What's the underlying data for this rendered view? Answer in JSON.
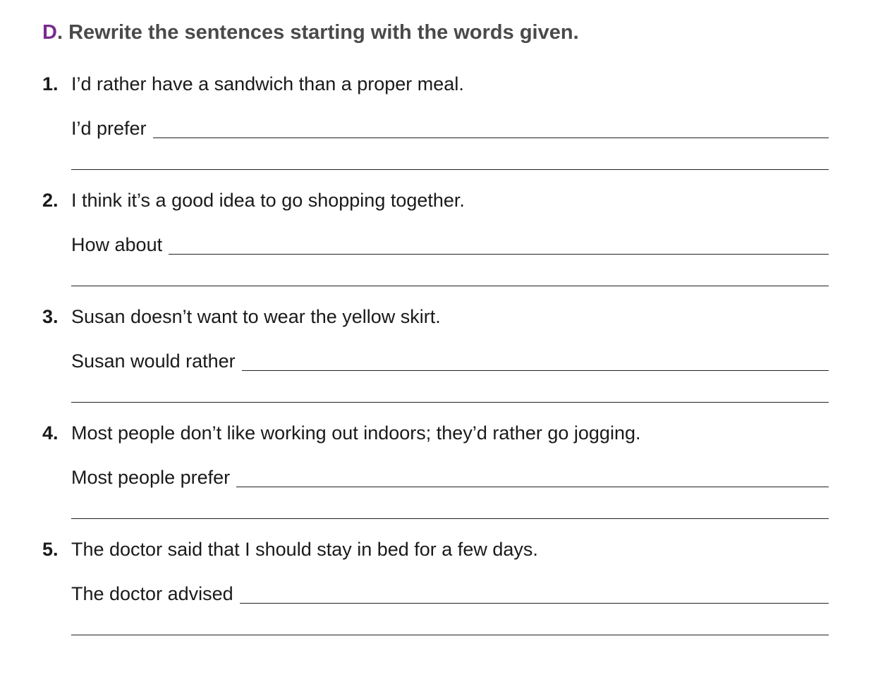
{
  "heading": {
    "letter": "D",
    "dot": ".",
    "instruction": "Rewrite the sentences starting with the words given."
  },
  "exercises": [
    {
      "number": "1.",
      "sentence": "I’d rather have a sandwich than a proper meal.",
      "prompt": "I’d prefer"
    },
    {
      "number": "2.",
      "sentence": "I think it’s a good idea to go shopping together.",
      "prompt": "How about"
    },
    {
      "number": "3.",
      "sentence": "Susan doesn’t want to wear the yellow skirt.",
      "prompt": "Susan would rather"
    },
    {
      "number": "4.",
      "sentence": "Most people don’t like working out indoors; they’d rather go jogging.",
      "prompt": "Most people prefer"
    },
    {
      "number": "5.",
      "sentence": "The doctor said that I should stay in bed for a few days.",
      "prompt": "The doctor advised"
    }
  ],
  "colors": {
    "heading_letter": "#7a2b8f",
    "heading_text": "#4a4a4a",
    "body_text": "#1a1a1a"
  }
}
